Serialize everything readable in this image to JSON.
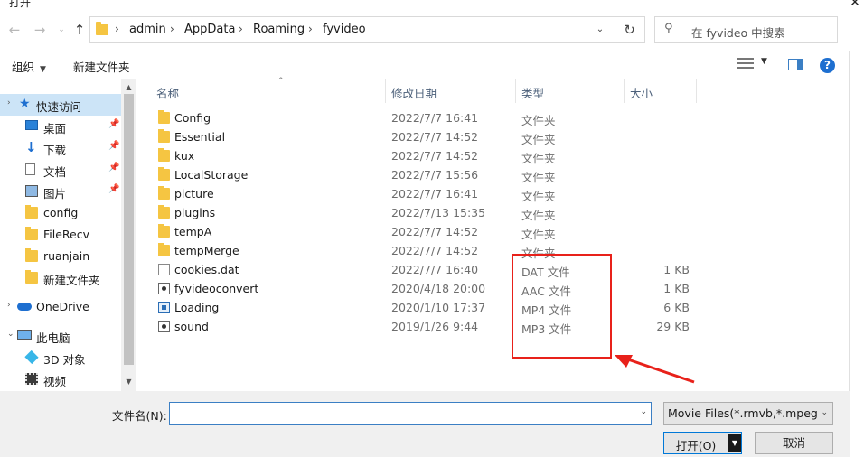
{
  "window": {
    "title": "打开"
  },
  "address": {
    "crumbs": [
      "admin",
      "AppData",
      "Roaming",
      "fyvideo"
    ]
  },
  "search": {
    "placeholder": "在 fyvideo 中搜索"
  },
  "toolbar": {
    "organize_label": "组织",
    "new_folder_label": "新建文件夹"
  },
  "sidebar": {
    "items": [
      {
        "label": "快速访问",
        "icon": "star-icon",
        "pinned": false
      },
      {
        "label": "桌面",
        "icon": "desktop-icon",
        "pinned": true
      },
      {
        "label": "下载",
        "icon": "download-icon",
        "pinned": true
      },
      {
        "label": "文档",
        "icon": "document-icon",
        "pinned": true
      },
      {
        "label": "图片",
        "icon": "picture-icon",
        "pinned": true
      },
      {
        "label": "config",
        "icon": "folder-icon",
        "pinned": false
      },
      {
        "label": "FileRecv",
        "icon": "folder-icon",
        "pinned": false
      },
      {
        "label": "ruanjain",
        "icon": "folder-icon",
        "pinned": false
      },
      {
        "label": "新建文件夹",
        "icon": "folder-icon",
        "pinned": false
      },
      {
        "label": "OneDrive",
        "icon": "cloud-icon",
        "pinned": false
      },
      {
        "label": "此电脑",
        "icon": "computer-icon",
        "pinned": false
      },
      {
        "label": "3D 对象",
        "icon": "cube-icon",
        "pinned": false
      },
      {
        "label": "视频",
        "icon": "video-icon",
        "pinned": false
      }
    ]
  },
  "columns": {
    "name": "名称",
    "date": "修改日期",
    "type": "类型",
    "size": "大小"
  },
  "files": [
    {
      "name": "Config",
      "date": "2022/7/7 16:41",
      "type": "文件夹",
      "size": "",
      "icon": "folder-icon"
    },
    {
      "name": "Essential",
      "date": "2022/7/7 14:52",
      "type": "文件夹",
      "size": "",
      "icon": "folder-icon"
    },
    {
      "name": "kux",
      "date": "2022/7/7 14:52",
      "type": "文件夹",
      "size": "",
      "icon": "folder-icon"
    },
    {
      "name": "LocalStorage",
      "date": "2022/7/7 15:56",
      "type": "文件夹",
      "size": "",
      "icon": "folder-icon"
    },
    {
      "name": "picture",
      "date": "2022/7/7 16:41",
      "type": "文件夹",
      "size": "",
      "icon": "folder-icon"
    },
    {
      "name": "plugins",
      "date": "2022/7/13 15:35",
      "type": "文件夹",
      "size": "",
      "icon": "folder-icon"
    },
    {
      "name": "tempA",
      "date": "2022/7/7 14:52",
      "type": "文件夹",
      "size": "",
      "icon": "folder-icon"
    },
    {
      "name": "tempMerge",
      "date": "2022/7/7 14:52",
      "type": "文件夹",
      "size": "",
      "icon": "folder-icon"
    },
    {
      "name": "cookies.dat",
      "date": "2022/7/7 16:40",
      "type": "DAT 文件",
      "size": "1 KB",
      "icon": "file-icon"
    },
    {
      "name": "fyvideoconvert",
      "date": "2020/4/18 20:00",
      "type": "AAC 文件",
      "size": "1 KB",
      "icon": "audio-file-icon"
    },
    {
      "name": "Loading",
      "date": "2020/1/10 17:37",
      "type": "MP4 文件",
      "size": "6 KB",
      "icon": "video-file-icon"
    },
    {
      "name": "sound",
      "date": "2019/1/26 9:44",
      "type": "MP3 文件",
      "size": "29 KB",
      "icon": "audio-file-icon"
    }
  ],
  "bottom": {
    "filename_label": "文件名(N):",
    "filename_value": "",
    "filter_value": "Movie Files(*.rmvb,*.mpeg,*.avi)",
    "open_label": "打开(O)",
    "cancel_label": "取消"
  },
  "colors": {
    "accent": "#0078d7",
    "highlight": "#e8211a",
    "folder": "#f5c542",
    "selected": "#cce4f7"
  }
}
